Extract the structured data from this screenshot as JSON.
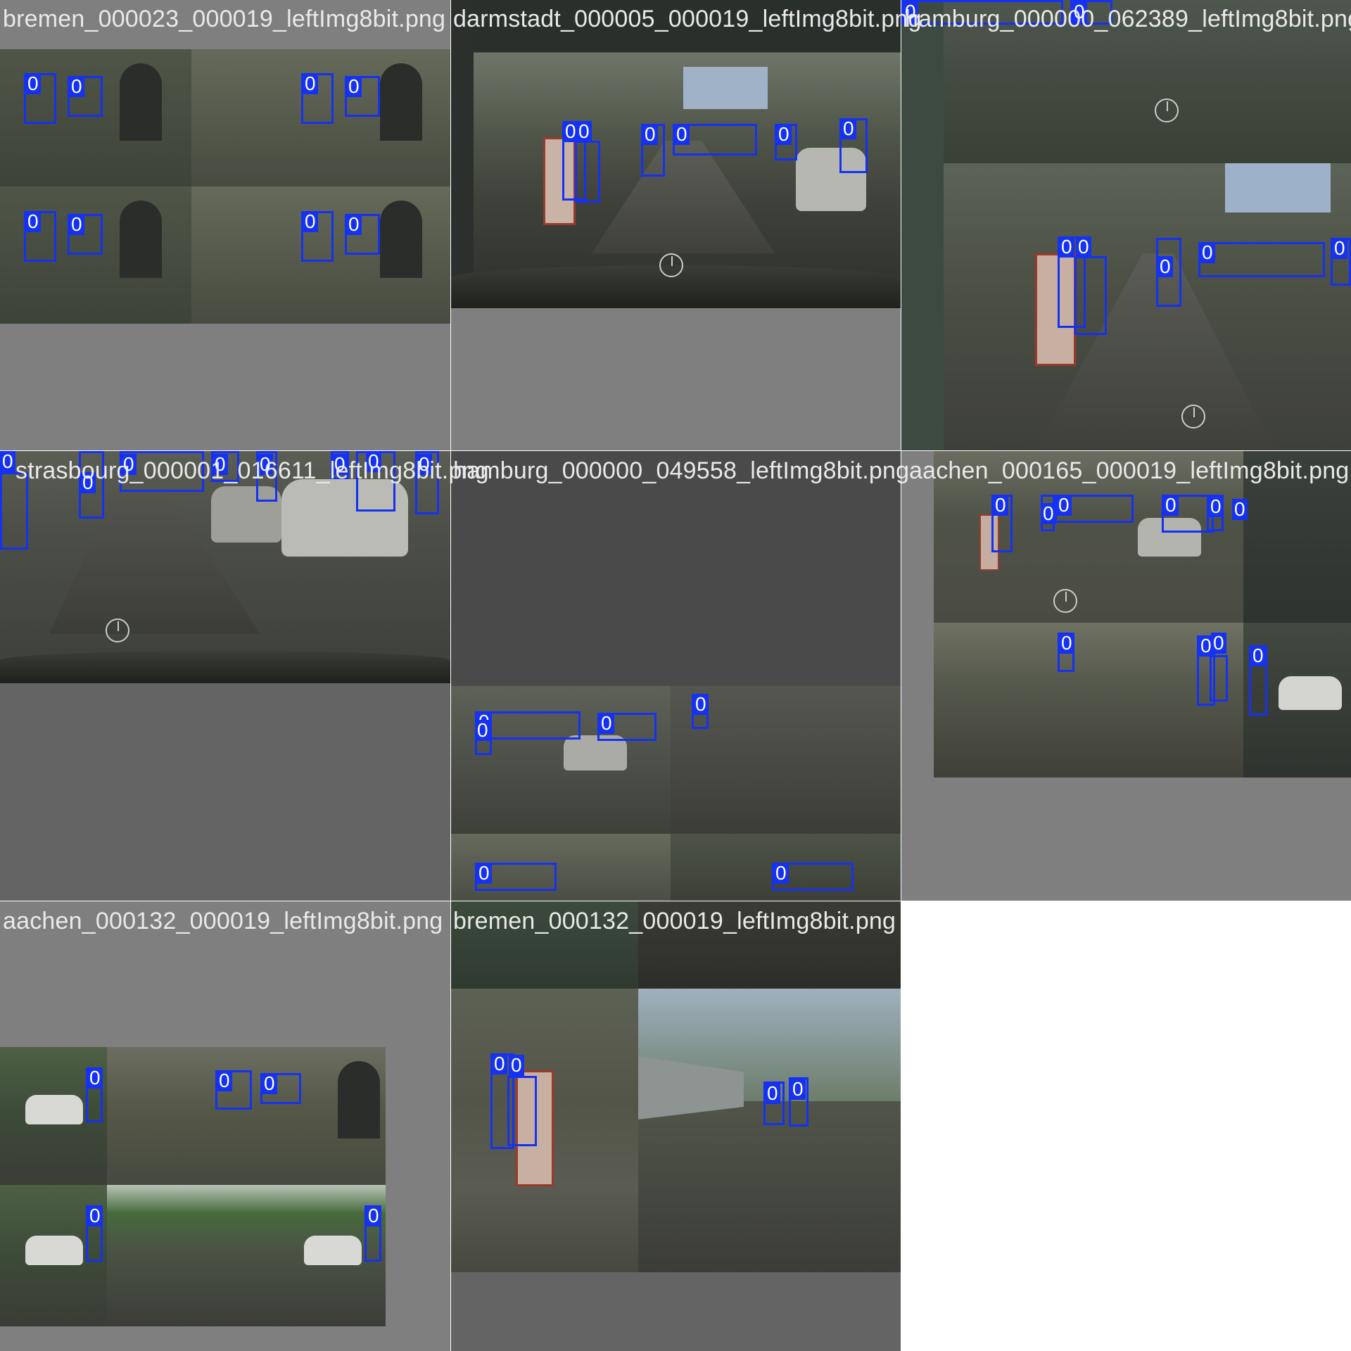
{
  "tiles": [
    {
      "caption": "bremen_000023_000019_leftImg8bit.png"
    },
    {
      "caption": "darmstadt_000005_000019_leftImg8bit.png"
    },
    {
      "caption": "hamburg_000000_062389_leftImg8bit.png"
    },
    {
      "caption": "strasbourg_000001_016611_leftImg8bit.png"
    },
    {
      "caption": "hamburg_000000_049558_leftImg8bit.png"
    },
    {
      "caption": "aachen_000165_000019_leftImg8bit.png"
    },
    {
      "caption": "aachen_000132_000019_leftImg8bit.png"
    },
    {
      "caption": "bremen_000132_000019_leftImg8bit.png"
    }
  ],
  "detection_label": "0",
  "colors": {
    "box": "#1531f2",
    "canvas_gray": "#7f7f7f",
    "dark_gray": "#4a4a4a",
    "mid_gray": "#646464"
  }
}
